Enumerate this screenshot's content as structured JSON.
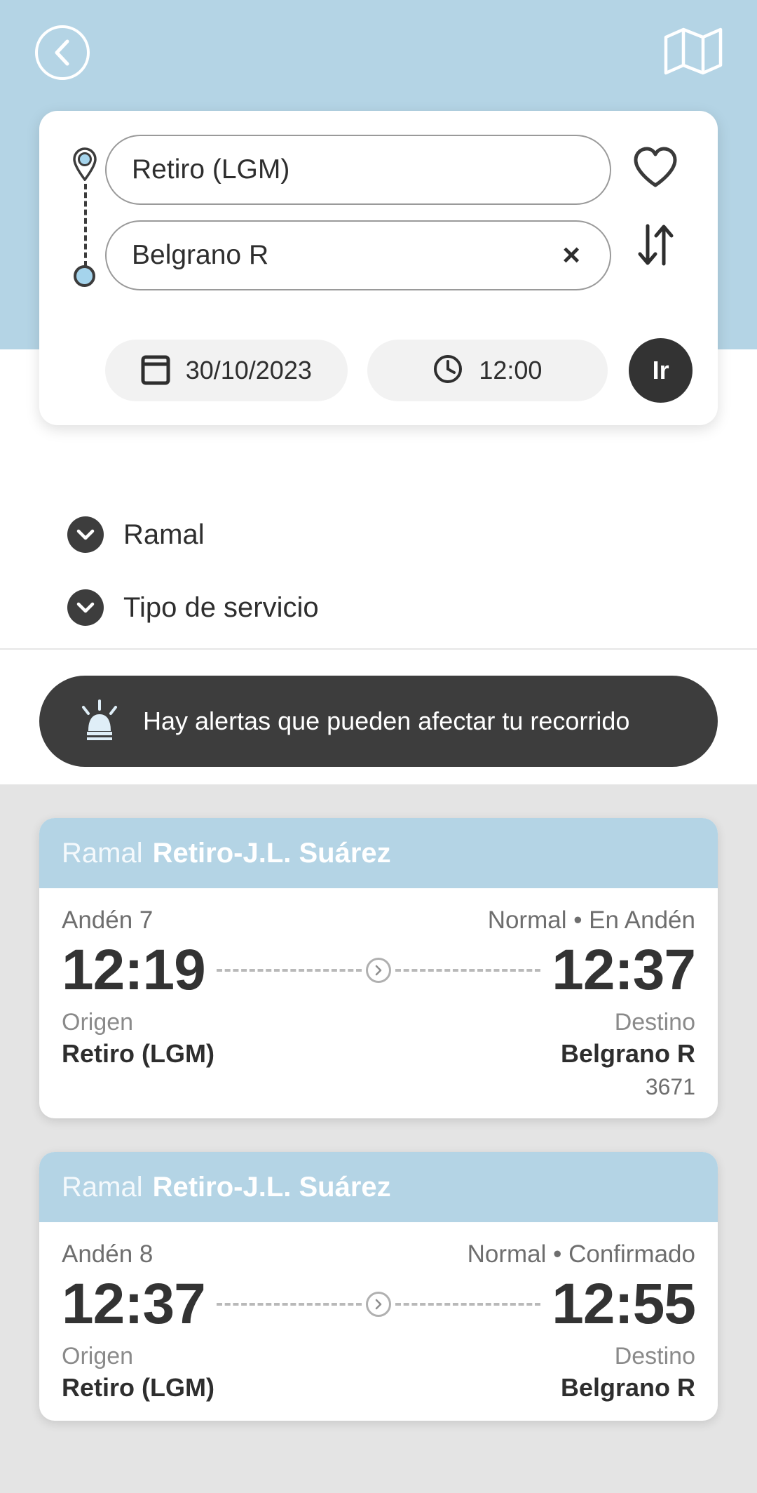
{
  "header": {
    "back_icon": "chevron-left-icon",
    "map_icon": "map-icon"
  },
  "search": {
    "origin": {
      "value": "Retiro (LGM)",
      "marker_icon": "location-pin-icon"
    },
    "destination": {
      "value": "Belgrano R",
      "marker_icon": "circle-dot-icon",
      "clear_label": "×"
    },
    "favorite_icon": "heart-icon",
    "swap_icon": "swap-vertical-icon",
    "date": {
      "value": "30/10/2023",
      "icon": "calendar-icon"
    },
    "time": {
      "value": "12:00",
      "icon": "clock-icon"
    },
    "go_button_label": "Ir"
  },
  "filters": [
    {
      "label": "Ramal",
      "icon": "chevron-down-icon"
    },
    {
      "label": "Tipo de servicio",
      "icon": "chevron-down-icon"
    }
  ],
  "alert": {
    "text": "Hay alertas que pueden afectar tu recorrido",
    "icon": "siren-icon"
  },
  "results": [
    {
      "ramal_prefix": "Ramal",
      "ramal_name": "Retiro-J.L. Suárez",
      "platform": "Andén 7",
      "status": "Normal • En Andén",
      "depart_time": "12:19",
      "arrive_time": "12:37",
      "origin_label": "Origen",
      "origin_name": "Retiro (LGM)",
      "destination_label": "Destino",
      "destination_name": "Belgrano R",
      "train_number": "3671"
    },
    {
      "ramal_prefix": "Ramal",
      "ramal_name": "Retiro-J.L. Suárez",
      "platform": "Andén 8",
      "status": "Normal • Confirmado",
      "depart_time": "12:37",
      "arrive_time": "12:55",
      "origin_label": "Origen",
      "origin_name": "Retiro (LGM)",
      "destination_label": "Destino",
      "destination_name": "Belgrano R",
      "train_number": ""
    }
  ],
  "colors": {
    "header_blue": "#b4d4e5",
    "dark": "#3d3d3d",
    "results_bg": "#e4e4e4"
  }
}
